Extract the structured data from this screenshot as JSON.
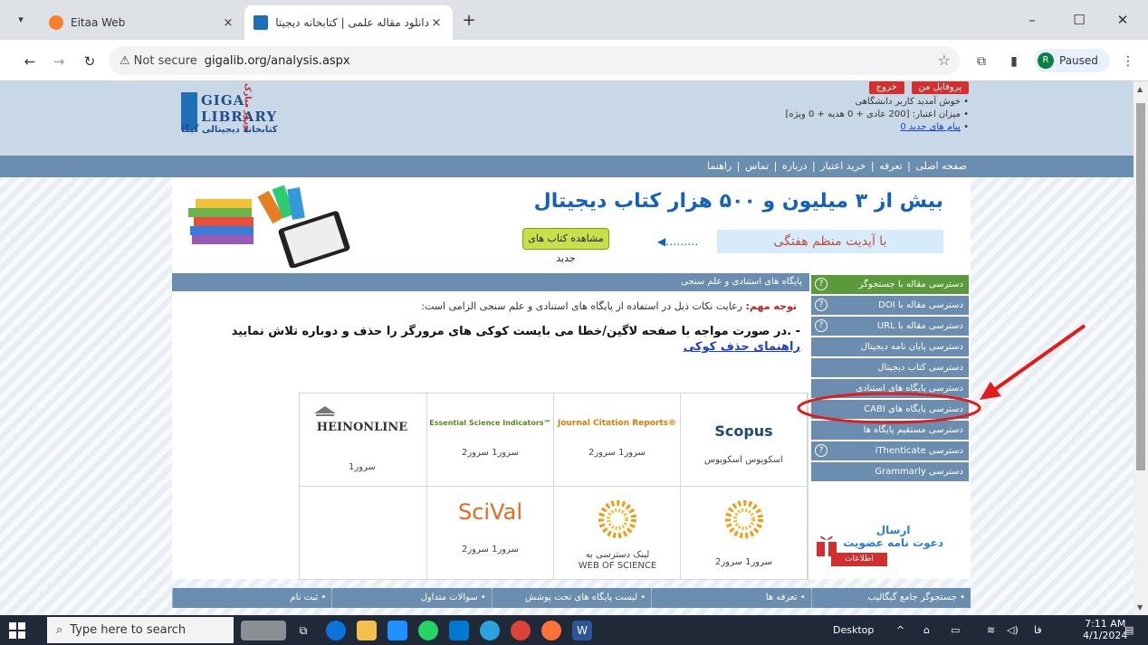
{
  "browser": {
    "tabs": [
      {
        "title": "Eitaa Web",
        "active": false
      },
      {
        "title": "دانلود مقاله علمی | کتابخانه دیجیتال",
        "active": true
      }
    ],
    "url_prefix": "Not secure",
    "url": "gigalib.org/analysis.aspx",
    "profile_initial": "R",
    "profile_status": "Paused"
  },
  "header": {
    "logo_text_1": "GIGA",
    "logo_text_2": "LIBRARY",
    "logo_subtitle": "کتابخانه دیجیتالی گیگا",
    "logo_ribbon": "نوروز مبارک",
    "profile_btn": "پروفایل من",
    "exit_btn": "خروج",
    "welcome": "• خوش آمدید کاربر دانشگاهی",
    "credit": "• میزان اعتبار: [200 عادی + 0 هدیه + 0 ویژه]",
    "messages": "پیام های جدید 0"
  },
  "menu": [
    "صفحه اصلی",
    "تعرفه",
    "خرید اعتبار",
    "درباره",
    "تماس",
    "راهنما"
  ],
  "banner": {
    "title": "بیش از ۳ میلیون و ۵۰۰ هزار کتاب دیجیتال",
    "subtitle": "با آپدیت منظم هفتگی",
    "button": "مشاهده کتاب های جدید"
  },
  "section": {
    "heading": "پایگاه های استنادی و علم سنجی",
    "notice_label": "توجه مهم:",
    "notice_text": " رعایت نکات ذیل در استفاده از پایگاه های استنادی و علم سنجی الزامی است:",
    "warning_text": "- .در صورت مواجه با صفحه لاگین/خطا می بایست کوکی های مرورگر را حذف و دوباره تلاش نمایید ",
    "warning_link": "راهنمای حذف کوکی"
  },
  "databases": [
    {
      "brand": "Scopus",
      "links": "اسکوپوس   اسکوپوس",
      "color": "#1b4a7b"
    },
    {
      "brand": "Journal Citation Reports®",
      "links": "سرور1   سرور2",
      "color": "#e07b00"
    },
    {
      "brand": "Essential Science Indicators℠",
      "links": "سرور1   سرور2",
      "color": "#5a8a1f"
    },
    {
      "brand": "HEINONLINE",
      "links": "سرور1",
      "color": "#333333"
    },
    {
      "brand": "",
      "links": "سرور1   سرور2",
      "color": "#f39c12"
    },
    {
      "brand": "",
      "links": "لینک دسترسی به WEB OF SCIENCE",
      "color": "#f39c12"
    },
    {
      "brand": "SciVal",
      "links": "سرور1   سرور2",
      "color": "#e8691d"
    },
    {
      "brand": "",
      "links": "",
      "color": "#ffffff"
    }
  ],
  "sidebar": [
    {
      "label": "دسترسی مقاله با جستجوگر",
      "help": true
    },
    {
      "label": "دسترسی مقاله با DOI",
      "help": true
    },
    {
      "label": "دسترسی مقاله با URL",
      "help": true
    },
    {
      "label": "دسترسی پایان نامه دیجیتال",
      "help": false
    },
    {
      "label": "دسترسی کتاب دیجیتال",
      "help": false
    },
    {
      "label": "دسترسی پایگاه های استنادی",
      "help": false
    },
    {
      "label": "دسترسی پایگاه های CABI",
      "help": false
    },
    {
      "label": "دسترسی مستقیم پایگاه ها",
      "help": false
    },
    {
      "label": "دسترسی iThenticate",
      "help": true
    },
    {
      "label": "دسترسی Grammarly",
      "help": false
    }
  ],
  "invite": {
    "line1": "ارسال",
    "line2": "دعوت نامه عضویت",
    "more": "اطلاعات بیشتر..."
  },
  "footer": [
    "• جستجوگر جامع گیگالیب",
    "• تعرفه ها",
    "• لیست پایگاه های تحت پوشش",
    "• سوالات متداول",
    "• ثبت نام"
  ],
  "taskbar": {
    "search_placeholder": "Type here to search",
    "desktop": "Desktop",
    "lang": "فا",
    "time": "7:11 AM",
    "date": "4/1/2024"
  },
  "colors": {
    "accent": "#6a8db0",
    "highlight": "#e21b1b"
  }
}
